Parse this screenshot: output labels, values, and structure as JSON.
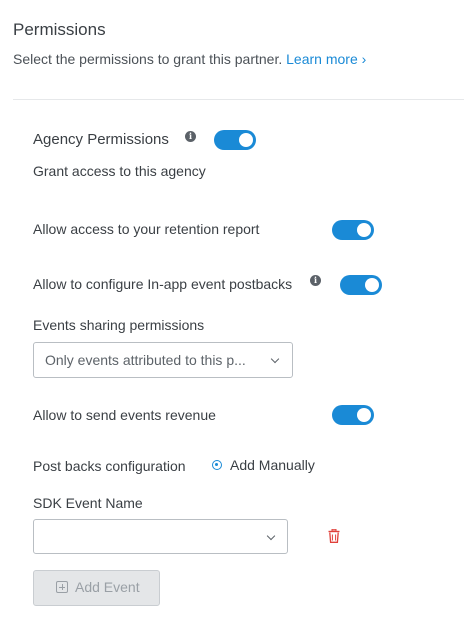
{
  "header": {
    "title": "Permissions",
    "subtitle": "Select the permissions to grant this partner.",
    "learn_more": "Learn more ›"
  },
  "agency": {
    "title": "Agency Permissions",
    "info_icon": "info-icon",
    "toggle_on": true,
    "grant_text": "Grant access to this agency"
  },
  "permissions": {
    "retention_label": "Allow access to your retention report",
    "retention_on": true,
    "postbacks_label": "Allow to configure In-app event postbacks",
    "postbacks_on": true,
    "events_sharing_label": "Events sharing permissions",
    "events_sharing_value": "Only events attributed to this p...",
    "revenue_label": "Allow to send events revenue",
    "revenue_on": true
  },
  "postbacks": {
    "config_label": "Post backs configuration",
    "radio_label": "Add Manually",
    "radio_selected": true,
    "sdk_event_label": "SDK Event Name",
    "sdk_event_value": "",
    "delete_icon": "trash-icon",
    "add_button": "Add Event",
    "add_button_enabled": false
  },
  "colors": {
    "accent": "#1a8ad6",
    "delete": "#e0403a",
    "text": "#3a3f44",
    "disabled_bg": "#e4e6e8"
  }
}
